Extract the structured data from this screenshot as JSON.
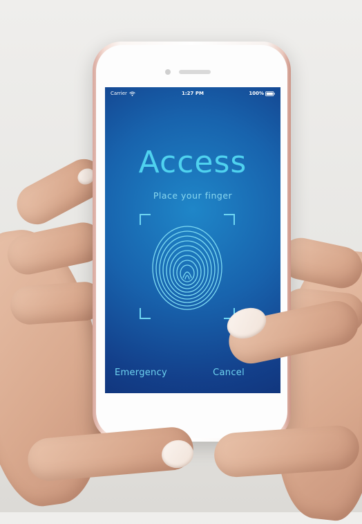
{
  "status_bar": {
    "carrier": "Carrier",
    "time": "1:27 PM",
    "battery": "100%"
  },
  "screen": {
    "title": "Access",
    "prompt": "Place your finger",
    "emergency_label": "Emergency",
    "cancel_label": "Cancel"
  },
  "icons": {
    "wifi": "wifi-icon",
    "battery": "battery-icon",
    "fingerprint": "fingerprint-icon"
  },
  "colors": {
    "accent": "#4fd2ef",
    "screen_top": "#1f86c8",
    "screen_bottom": "#0e2b6e"
  }
}
